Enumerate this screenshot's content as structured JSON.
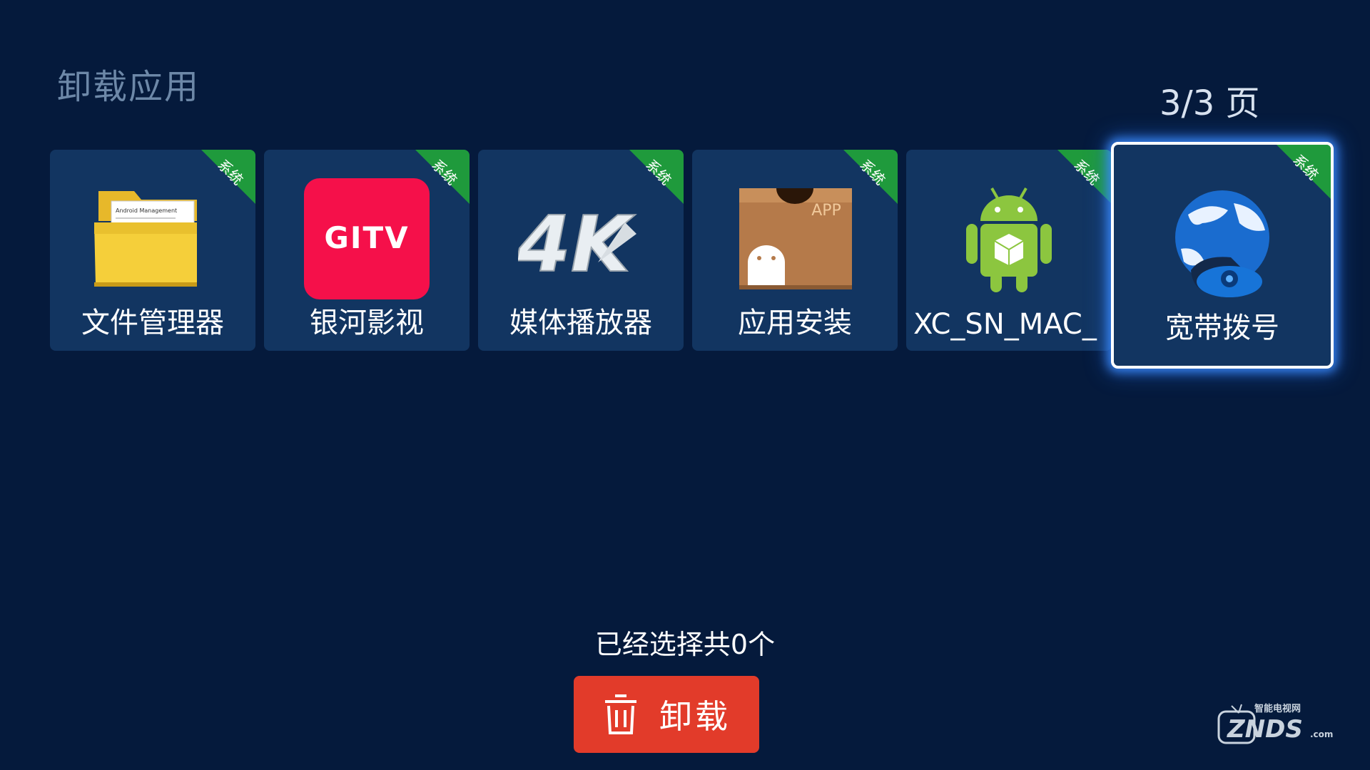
{
  "header": {
    "title": "卸载应用",
    "page_indicator": "3/3 页"
  },
  "apps": [
    {
      "label": "文件管理器",
      "badge": "系统",
      "icon": "folder-icon",
      "icon_text": "Android Management"
    },
    {
      "label": "银河影视",
      "badge": "系统",
      "icon": "gitv-logo-icon",
      "icon_text": "GITV"
    },
    {
      "label": "媒体播放器",
      "badge": "系统",
      "icon": "4k-player-icon",
      "icon_text": "4K"
    },
    {
      "label": "应用安装",
      "badge": "系统",
      "icon": "app-box-icon",
      "icon_text": "APP"
    },
    {
      "label": "XC_SN_MAC_",
      "badge": "系统",
      "icon": "android-icon"
    },
    {
      "label": "宽带拨号",
      "badge": "系统",
      "icon": "globe-phone-icon",
      "focused": true
    }
  ],
  "footer": {
    "selected_text": "已经选择共0个",
    "uninstall_label": "卸载"
  },
  "watermark": {
    "brand": "ZNDS",
    "suffix": ".com",
    "tagline": "智能电视网"
  },
  "colors": {
    "background": "#051a3c",
    "tile": "#123561",
    "badge": "#1f9a3c",
    "button": "#e23b2a",
    "focus_glow": "#3c8cff"
  }
}
